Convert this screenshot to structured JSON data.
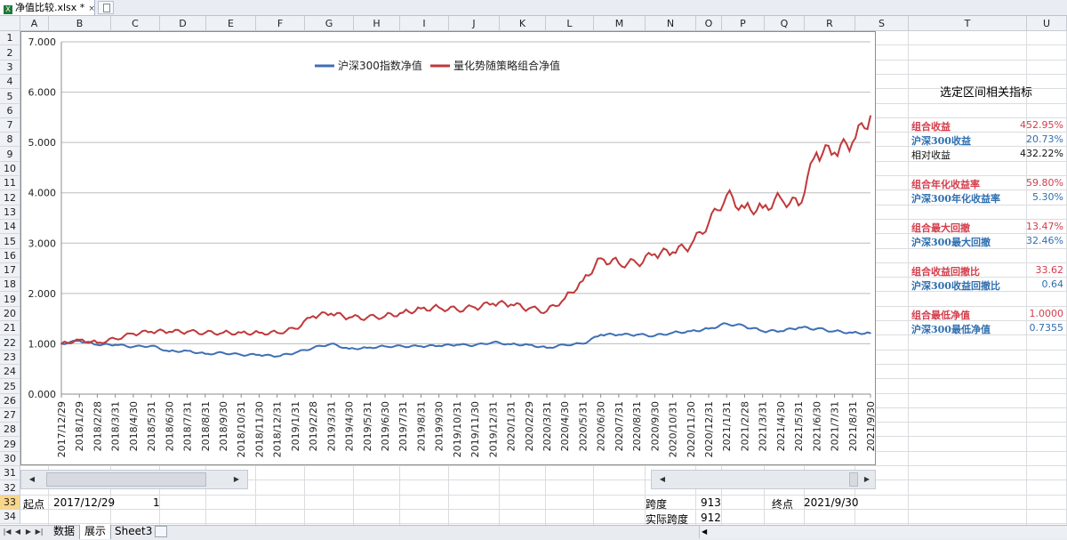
{
  "window": {
    "file_tab": "净值比较.xlsx *",
    "close_symbol": "×"
  },
  "columns": [
    "A",
    "B",
    "C",
    "D",
    "E",
    "F",
    "G",
    "H",
    "I",
    "J",
    "K",
    "L",
    "M",
    "N",
    "O",
    "P",
    "Q",
    "R",
    "S",
    "T",
    "U"
  ],
  "rows": [
    "1",
    "2",
    "3",
    "4",
    "5",
    "6",
    "7",
    "8",
    "9",
    "10",
    "11",
    "12",
    "13",
    "14",
    "15",
    "16",
    "17",
    "18",
    "19",
    "20",
    "21",
    "22",
    "23",
    "24",
    "25",
    "26",
    "27",
    "28",
    "29",
    "30",
    "31",
    "32",
    "33",
    "34"
  ],
  "selected_row": "33",
  "panel": {
    "title": "选定区间相关指标",
    "metrics": [
      {
        "label": "组合收益",
        "value": "452.95%",
        "color": "red"
      },
      {
        "label": "沪深300收益",
        "value": "20.73%",
        "color": "blue"
      },
      {
        "label": "相对收益",
        "value": "432.22%",
        "color": "blk"
      },
      {
        "label": "组合年化收益率",
        "value": "59.80%",
        "color": "red"
      },
      {
        "label": "沪深300年化收益率",
        "value": "5.30%",
        "color": "blue"
      },
      {
        "label": "组合最大回撤",
        "value": "13.47%",
        "color": "red"
      },
      {
        "label": "沪深300最大回撤",
        "value": "32.46%",
        "color": "blue"
      },
      {
        "label": "组合收益回撤比",
        "value": "33.62",
        "color": "red"
      },
      {
        "label": "沪深300收益回撤比",
        "value": "0.64",
        "color": "blue"
      },
      {
        "label": "组合最低净值",
        "value": "1.0000",
        "color": "red"
      },
      {
        "label": "沪深300最低净值",
        "value": "0.7355",
        "color": "blue"
      }
    ]
  },
  "cells": {
    "start_label": "起点",
    "start_date": "2017/12/29",
    "start_value": "1",
    "span_label": "跨度",
    "span_value": "913",
    "end_label": "终点",
    "end_date": "2021/9/30",
    "actual_span_label": "实际跨度",
    "actual_span_value": "912"
  },
  "sheet_tabs": [
    "数据",
    "展示",
    "Sheet3"
  ],
  "active_sheet": "展示",
  "chart_data": {
    "type": "line",
    "title": "",
    "ylim": [
      0,
      7
    ],
    "yticks": [
      "0.000",
      "1.000",
      "2.000",
      "3.000",
      "4.000",
      "5.000",
      "6.000",
      "7.000"
    ],
    "grid": true,
    "legend_position": "top-center",
    "x": [
      "2017/12/29",
      "2018/1/29",
      "2018/2/28",
      "2018/3/31",
      "2018/4/30",
      "2018/5/31",
      "2018/6/30",
      "2018/7/31",
      "2018/8/31",
      "2018/9/30",
      "2018/10/31",
      "2018/11/30",
      "2018/12/31",
      "2019/1/31",
      "2019/2/28",
      "2019/3/31",
      "2019/4/30",
      "2019/5/31",
      "2019/6/30",
      "2019/7/31",
      "2019/8/31",
      "2019/9/30",
      "2019/10/31",
      "2019/11/30",
      "2019/12/31",
      "2020/1/31",
      "2020/2/29",
      "2020/3/31",
      "2020/4/30",
      "2020/5/31",
      "2020/6/30",
      "2020/7/31",
      "2020/8/31",
      "2020/9/30",
      "2020/10/31",
      "2020/11/30",
      "2020/12/31",
      "2021/1/31",
      "2021/2/28",
      "2021/3/31",
      "2021/4/30",
      "2021/5/31",
      "2021/6/30",
      "2021/7/31",
      "2021/8/31",
      "2021/9/30"
    ],
    "series": [
      {
        "name": "沪深300指数净值",
        "color": "#3f6fb5",
        "values": [
          1.0,
          1.06,
          0.98,
          0.98,
          0.94,
          0.96,
          0.85,
          0.86,
          0.8,
          0.82,
          0.78,
          0.78,
          0.75,
          0.82,
          0.92,
          1.0,
          0.9,
          0.92,
          0.95,
          0.95,
          0.95,
          0.96,
          0.98,
          0.97,
          1.03,
          0.99,
          0.98,
          0.92,
          0.98,
          1.0,
          1.18,
          1.18,
          1.18,
          1.16,
          1.22,
          1.25,
          1.3,
          1.4,
          1.35,
          1.25,
          1.25,
          1.32,
          1.3,
          1.25,
          1.22,
          1.21
        ]
      },
      {
        "name": "量化势随策略组合净值",
        "color": "#c0393b",
        "values": [
          1.0,
          1.08,
          1.02,
          1.1,
          1.2,
          1.24,
          1.24,
          1.24,
          1.22,
          1.22,
          1.22,
          1.22,
          1.22,
          1.3,
          1.55,
          1.6,
          1.52,
          1.52,
          1.55,
          1.62,
          1.7,
          1.72,
          1.68,
          1.72,
          1.8,
          1.78,
          1.7,
          1.65,
          1.9,
          2.25,
          2.7,
          2.6,
          2.6,
          2.78,
          2.82,
          2.95,
          3.4,
          3.95,
          3.7,
          3.7,
          3.9,
          3.75,
          4.8,
          4.8,
          5.0,
          5.53
        ]
      }
    ]
  }
}
